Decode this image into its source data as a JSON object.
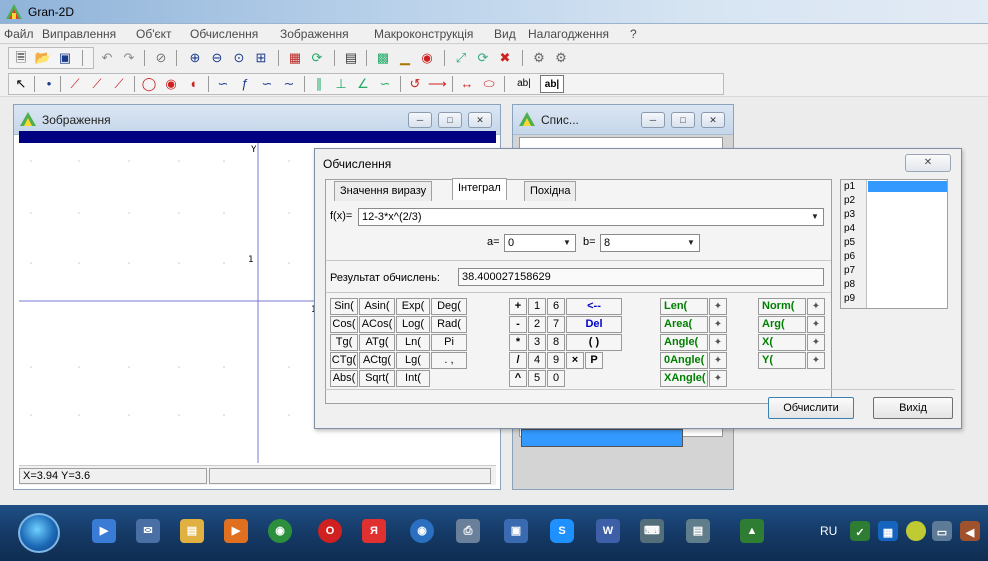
{
  "app": {
    "title": "Gran-2D"
  },
  "menu": [
    "Файл",
    "Виправлення",
    "Об'єкт",
    "Обчислення",
    "Зображення",
    "Макроконструкція",
    "Вид",
    "Налагодження",
    "?"
  ],
  "plot_window": {
    "title": "Зображення",
    "axis_y_label": "Y",
    "tick_y": "1",
    "tick_x": "1",
    "status": "X=3.94 Y=3.6"
  },
  "list_window": {
    "title": "Спис..."
  },
  "dialog": {
    "title": "Обчислення",
    "tabs": [
      "Значення виразу",
      "Інтеграл",
      "Похідна"
    ],
    "active_tab": "Інтеграл",
    "fx_label": "f(x)=",
    "fx_value": "12-3*x^(2/3)",
    "a_label": "a=",
    "a_value": "0",
    "b_label": "b=",
    "b_value": "8",
    "result_label": "Результат обчислень:",
    "result_value": "38.400027158629",
    "func_keys": [
      [
        "Sin(",
        "Asin(",
        "Exp(",
        "Deg("
      ],
      [
        "Cos(",
        "ACos(",
        "Log(",
        "Rad("
      ],
      [
        "Tg(",
        "ATg(",
        "Ln(",
        "Pi"
      ],
      [
        "CTg(",
        "ACtg(",
        "Lg(",
        ". ,"
      ],
      [
        "Abs(",
        "Sqrt(",
        "Int(",
        ""
      ]
    ],
    "ops": [
      "+",
      "-",
      "*",
      "/",
      "^"
    ],
    "digits_col1": [
      "1",
      "2",
      "3",
      "4",
      "5"
    ],
    "digits_col2": [
      "6",
      "7",
      "8",
      "9",
      "0"
    ],
    "edit_keys": [
      "<--",
      "Del",
      "( )",
      "×"
    ],
    "p_key": "P",
    "geo_keys_left": [
      "Len(",
      "Area(",
      "Angle(",
      "0Angle(",
      "XAngle("
    ],
    "geo_keys_right": [
      "Norm(",
      "Arg(",
      "X(",
      "Y("
    ],
    "points": [
      "p1",
      "p2",
      "p3",
      "p4",
      "p5",
      "p6",
      "p7",
      "p8",
      "p9"
    ],
    "calc_button": "Обчислити",
    "exit_button": "Вихід"
  },
  "taskbar": {
    "lang": "RU"
  },
  "colors": {
    "accent": "#3399ff",
    "title_band": "#000080",
    "green_keys": "#008000",
    "blue_keys": "#0000c8"
  }
}
